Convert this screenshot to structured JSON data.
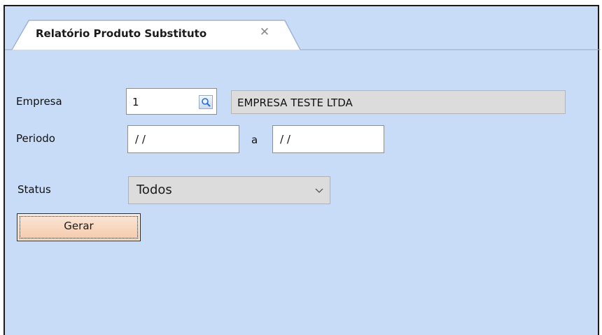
{
  "tab": {
    "title": "Relatório Produto Substituto",
    "close_glyph": "✕"
  },
  "form": {
    "empresa": {
      "label": "Empresa",
      "code": "1",
      "name": "EMPRESA TESTE LTDA"
    },
    "periodo": {
      "label": "Periodo",
      "from": "/ /",
      "separator": "a",
      "to": "/ /"
    },
    "status": {
      "label": "Status",
      "selected": "Todos"
    },
    "generate_label": "Gerar"
  },
  "colors": {
    "panel_bg": "#c9dcf7",
    "button_bg": "#f5c9a8",
    "field_bg": "#ffffff",
    "readonly_bg": "#dcdcdc"
  },
  "icons": {
    "lookup": "magnifier-icon",
    "dropdown": "chevron-down-icon",
    "close": "close-icon"
  }
}
